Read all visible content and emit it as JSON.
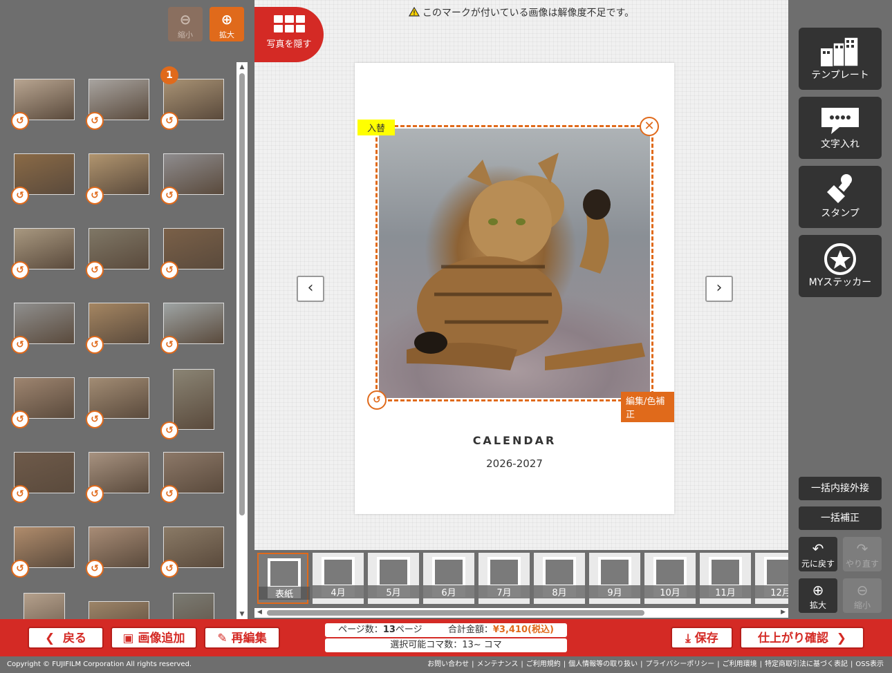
{
  "left_panel": {
    "zoom_out_label": "縮小",
    "zoom_in_label": "拡大",
    "selected_badge": "1",
    "thumbnails": [
      {
        "color": "#b8a591"
      },
      {
        "color": "#a8a4a0"
      },
      {
        "color": "#a89274"
      },
      {
        "color": "#8a6a46"
      },
      {
        "color": "#b1956f"
      },
      {
        "color": "#8e8c8e"
      },
      {
        "color": "#a89880"
      },
      {
        "color": "#7f7766"
      },
      {
        "color": "#7a6048"
      },
      {
        "color": "#8f8f8e"
      },
      {
        "color": "#a58662"
      },
      {
        "color": "#9ea4a4"
      },
      {
        "color": "#9e8570"
      },
      {
        "color": "#a28c74"
      },
      {
        "color": "#8a8474"
      },
      {
        "color": "#6e5a4a"
      },
      {
        "color": "#a79280"
      },
      {
        "color": "#8c7868"
      },
      {
        "color": "#b08c6c"
      },
      {
        "color": "#a88c76"
      },
      {
        "color": "#8a7a66"
      },
      {
        "color": "#b4a08c"
      },
      {
        "color": "#9c8468"
      },
      {
        "color": "#7a7a72"
      }
    ]
  },
  "center": {
    "warning_text": "このマークが付いている画像は解像度不足です。",
    "hide_photos_label": "写真を隠す",
    "replace_label": "入替",
    "edit_label": "編集/色補正",
    "calendar_title": "CALENDAR",
    "calendar_year": "2026-2027"
  },
  "page_strip": {
    "pages": [
      {
        "label": "表紙"
      },
      {
        "label": "4月"
      },
      {
        "label": "5月"
      },
      {
        "label": "6月"
      },
      {
        "label": "7月"
      },
      {
        "label": "8月"
      },
      {
        "label": "9月"
      },
      {
        "label": "10月"
      },
      {
        "label": "11月"
      },
      {
        "label": "12月"
      }
    ]
  },
  "right_panel": {
    "template_label": "テンプレート",
    "text_label": "文字入れ",
    "stamp_label": "スタンプ",
    "mysticker_label": "MYステッカー",
    "fit_all_label": "一括内接外接",
    "correct_all_label": "一括補正",
    "undo_label": "元に戻す",
    "redo_label": "やり直す",
    "zoom_in_label": "拡大",
    "zoom_out_label": "縮小"
  },
  "bottom_bar": {
    "back_label": "戻る",
    "add_image_label": "画像追加",
    "reedit_label": "再編集",
    "page_count_label": "ページ数：",
    "page_count_value": "13",
    "page_count_unit": "ページ",
    "total_label": "合計金額：",
    "total_value": "¥3,410(税込)",
    "frames_text": "選択可能コマ数：13~ コマ",
    "save_label": "保存",
    "confirm_label": "仕上がり確認"
  },
  "footer": {
    "copyright": "Copyright © FUJIFILM Corporation All rights reserved.",
    "links": [
      "お問い合わせ",
      "メンテナンス",
      "ご利用規約",
      "個人情報等の取り扱い",
      "プライバシーポリシー",
      "ご利用環境",
      "特定商取引法に基づく表記",
      "OSS表示"
    ]
  },
  "colors": {
    "accent": "#e06a1b",
    "brand_red": "#d42a25",
    "tool_dark": "#333333",
    "panel_gray": "#6e6e6e"
  }
}
